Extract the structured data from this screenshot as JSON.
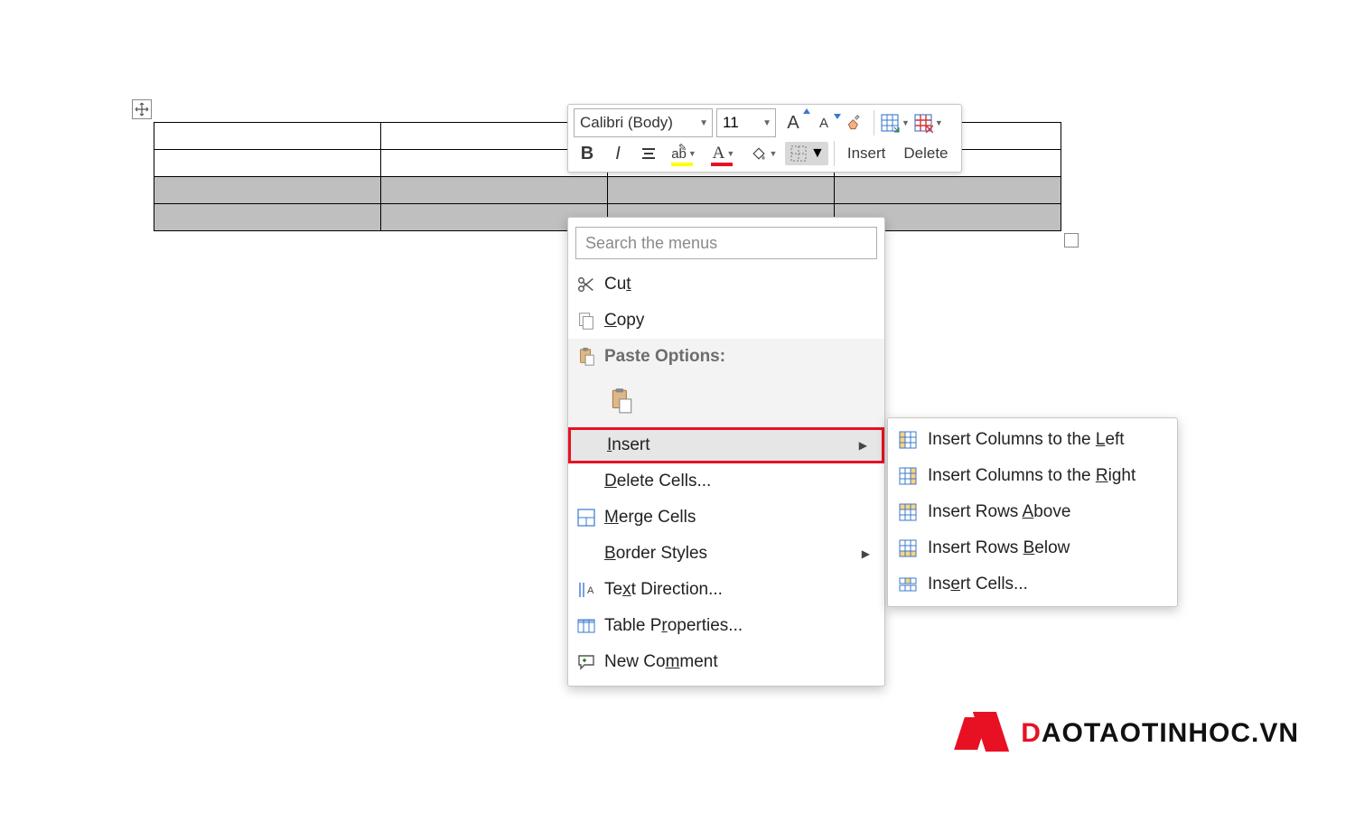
{
  "table": {
    "rows": 4,
    "cols": 4,
    "selected_rows": [
      2,
      3
    ]
  },
  "mini_toolbar": {
    "font_name": "Calibri (Body)",
    "font_size": "11",
    "grow_font": "A",
    "shrink_font": "A",
    "format_painter": "",
    "bold": "B",
    "italic": "I",
    "strike": "ab",
    "insert_label": "Insert",
    "delete_label": "Delete"
  },
  "context_menu": {
    "search_placeholder": "Search the menus",
    "cut": "Cut",
    "copy": "Copy",
    "paste_options": "Paste Options:",
    "insert": "Insert",
    "delete_cells": "Delete Cells...",
    "merge_cells": "Merge Cells",
    "border_styles": "Border Styles",
    "text_direction": "Text Direction...",
    "table_properties": "Table Properties...",
    "new_comment": "New Comment"
  },
  "submenu": {
    "insert_cols_left": "Insert Columns to the Left",
    "insert_cols_right": "Insert Columns to the Right",
    "insert_rows_above": "Insert Rows Above",
    "insert_rows_below": "Insert Rows Below",
    "insert_cells": "Insert Cells..."
  },
  "watermark": {
    "text": "DAOTAOTINHOC.VN"
  }
}
